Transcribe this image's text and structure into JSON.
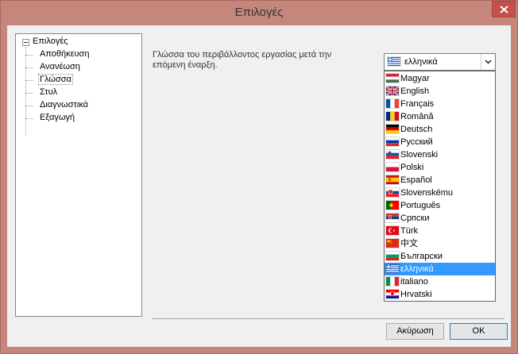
{
  "window": {
    "title": "Επιλογές"
  },
  "tree": {
    "root": "Επιλογές",
    "items": [
      {
        "label": "Αποθήκευση"
      },
      {
        "label": "Ανανέωση"
      },
      {
        "label": "Γλώσσα",
        "selected": true
      },
      {
        "label": "Στυλ"
      },
      {
        "label": "Διαγνωστικά"
      },
      {
        "label": "Εξαγωγή"
      }
    ]
  },
  "language": {
    "description": "Γλώσσα του περιβάλλοντος εργασίας μετά την επόμενη έναρξη.",
    "selected": "ελληνικά",
    "selected_flag": "flag-greece-icon",
    "options": [
      {
        "label": "Magyar",
        "icon": "flag-hungary-icon"
      },
      {
        "label": "English",
        "icon": "flag-uk-icon"
      },
      {
        "label": "Français",
        "icon": "flag-france-icon"
      },
      {
        "label": "Română",
        "icon": "flag-romania-icon"
      },
      {
        "label": "Deutsch",
        "icon": "flag-germany-icon"
      },
      {
        "label": "Русский",
        "icon": "flag-russia-icon"
      },
      {
        "label": "Slovenski",
        "icon": "flag-slovenia-icon"
      },
      {
        "label": "Polski",
        "icon": "flag-poland-icon"
      },
      {
        "label": "Español",
        "icon": "flag-spain-icon"
      },
      {
        "label": "Slovenskému",
        "icon": "flag-slovakia-icon"
      },
      {
        "label": "Português",
        "icon": "flag-portugal-icon"
      },
      {
        "label": "Српски",
        "icon": "flag-serbia-icon"
      },
      {
        "label": "Türk",
        "icon": "flag-turkey-icon"
      },
      {
        "label": "中文",
        "icon": "flag-china-icon"
      },
      {
        "label": "Български",
        "icon": "flag-bulgaria-icon"
      },
      {
        "label": "ελληνικά",
        "icon": "flag-greece-icon",
        "highlighted": true
      },
      {
        "label": "italiano",
        "icon": "flag-italy-icon"
      },
      {
        "label": "Hrvatski",
        "icon": "flag-croatia-icon"
      }
    ]
  },
  "buttons": {
    "cancel": "Ακύρωση",
    "ok": "OK"
  },
  "colors": {
    "frame": "#c5877c",
    "close": "#c7504a",
    "highlight": "#3399ff",
    "client": "#f0f0f0"
  }
}
